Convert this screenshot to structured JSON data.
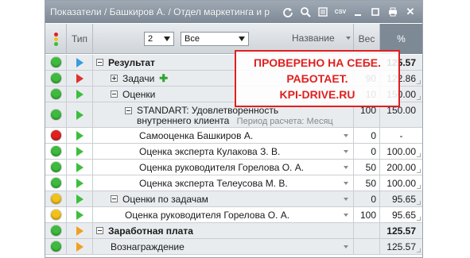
{
  "window": {
    "title": "Показатели / Башкиров А. / Отдел маркетинга и р"
  },
  "toolbar": {
    "icons": [
      "refresh-icon",
      "search-icon",
      "list-icon",
      "csv-icon",
      "minimize-icon",
      "maximize-icon",
      "print-icon",
      "close-icon"
    ],
    "csv_label": "CSV",
    "close_label": "✕"
  },
  "header": {
    "type_label": "Тип",
    "name_label": "Название",
    "weight_label": "Вес",
    "percent_label": "%",
    "level_value": "2",
    "filter_value": "Все"
  },
  "colors": {
    "green": "#3dbb3d",
    "red": "#e02020",
    "yellow": "#f2c21a",
    "blue_arrow": "#3a9be0",
    "red_arrow": "#e03030",
    "green_arrow": "#3cbf3c",
    "orange_arrow": "#f0a020"
  },
  "rows": [
    {
      "status": "green",
      "type": "blue",
      "name": "Результат",
      "weight": "",
      "percent": "125.57"
    },
    {
      "status": "green",
      "type": "red",
      "name": "Задачи",
      "weight": "90",
      "percent": "122.86"
    },
    {
      "status": "green",
      "type": "green",
      "name": "Оценки",
      "weight": "10",
      "percent": "150.00"
    },
    {
      "status": "green",
      "type": "green",
      "name": "STANDART: Удовлетворенность",
      "name_line2": "внутреннего клиента",
      "sub": "Период расчета: Месяц",
      "weight": "100",
      "percent": "150.00"
    },
    {
      "status": "red",
      "type": "green",
      "name": "Самооценка Башкиров А.",
      "weight": "0",
      "percent": "-"
    },
    {
      "status": "green",
      "type": "green",
      "name": "Оценка эксперта Кулакова З. В.",
      "weight": "0",
      "percent": "100.00"
    },
    {
      "status": "green",
      "type": "green",
      "name": "Оценка руководителя Горелова О. А.",
      "weight": "50",
      "percent": "200.00"
    },
    {
      "status": "green",
      "type": "green",
      "name": "Оценка эксперта Телеусова М. В.",
      "weight": "50",
      "percent": "100.00"
    },
    {
      "status": "yellow",
      "type": "green",
      "name": "Оценки по задачам",
      "weight": "0",
      "percent": "95.65"
    },
    {
      "status": "yellow",
      "type": "green",
      "name": "Оценка руководителя Горелова О. А.",
      "weight": "100",
      "percent": "95.65"
    },
    {
      "status": "green",
      "type": "orange",
      "name": "Заработная плата",
      "weight": "",
      "percent": "125.57"
    },
    {
      "status": "green",
      "type": "orange",
      "name": "Вознаграждение",
      "weight": "",
      "percent": "125.57"
    }
  ],
  "stamp": {
    "line1": "ПРОВЕРЕНО НА СЕБЕ.",
    "line2": "РАБОТАЕТ.",
    "line3": "KPI-DRIVE.RU"
  }
}
